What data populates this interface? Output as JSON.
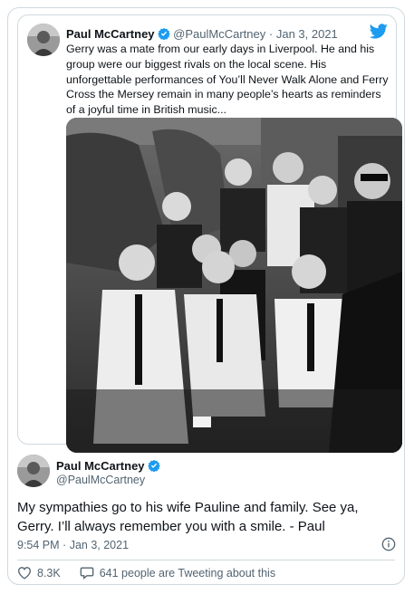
{
  "colors": {
    "brand_blue": "#1d9bf0",
    "text": "#0f1419",
    "muted": "#536471",
    "border": "#cfd9de"
  },
  "quoted": {
    "author_name": "Paul McCartney",
    "handle": "@PaulMcCartney",
    "separator": "·",
    "date": "Jan 3, 2021",
    "text": "Gerry was a mate from our early days in Liverpool. He and his group were our biggest rivals on the local scene. His unforgettable performances of You’ll Never Walk Alone and Ferry Cross the Mersey remain in many people’s hearts as reminders of a joyful time in British music...",
    "icons": {
      "avatar": "profile-photo",
      "verified": "verified-badge-icon",
      "logo": "twitter-bird-icon"
    }
  },
  "main": {
    "author_name": "Paul McCartney",
    "handle": "@PaulMcCartney",
    "text": "My sympathies go to his wife Pauline and family. See ya, Gerry. I’ll always remember you with a smile. - Paul",
    "time": "9:54 PM",
    "separator": "·",
    "date": "Jan 3, 2021",
    "likes": "8.3K",
    "conversation": "641 people are Tweeting about this",
    "icons": {
      "info": "info-icon",
      "like": "heart-icon",
      "reply": "speech-bubble-icon"
    }
  }
}
